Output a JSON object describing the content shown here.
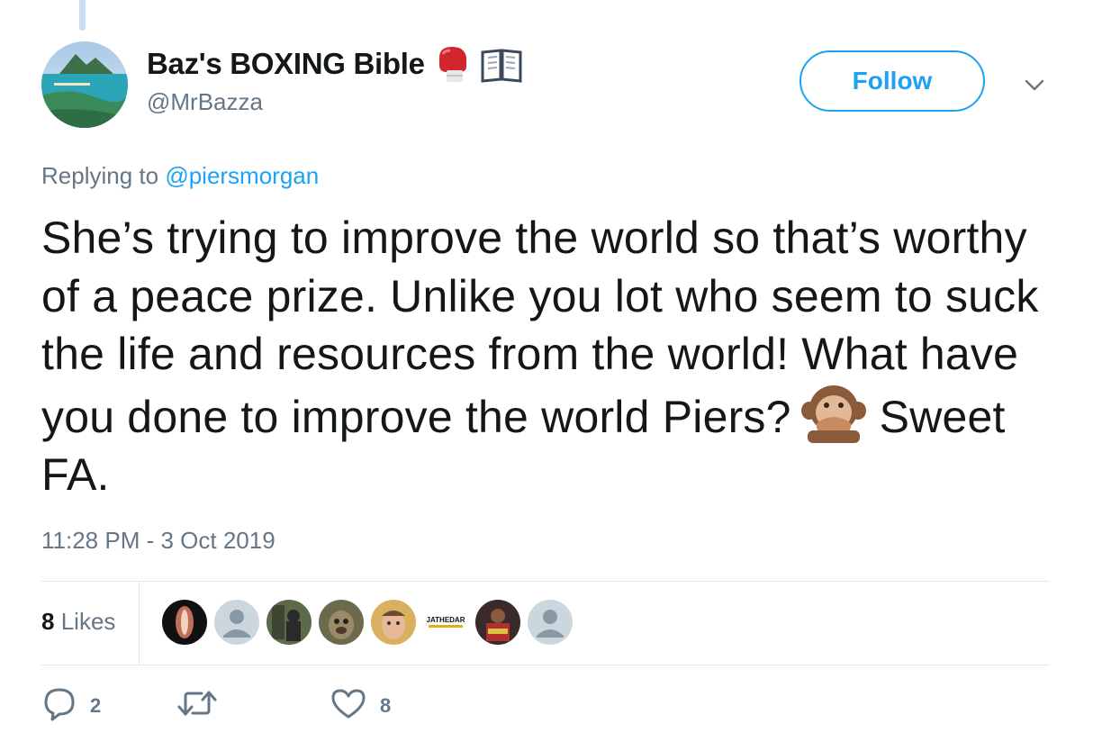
{
  "user": {
    "display_name": "Baz's BOXING Bible",
    "handle": "@MrBazza",
    "name_emojis": [
      "boxing-glove-icon",
      "open-book-icon"
    ]
  },
  "follow_button": {
    "label": "Follow"
  },
  "reply_context": {
    "prefix": "Replying to",
    "mention": "@piersmorgan"
  },
  "tweet": {
    "text_before_emoji": "She’s trying to improve the world so that’s worthy of a peace prize. Unlike you lot who seem to suck the life and resources from the world! What have you done to improve the world Piers?",
    "inline_emoji": "speak-no-evil-monkey-icon",
    "text_after_emoji": "Sweet FA.",
    "timestamp": "11:28 PM - 3 Oct 2019"
  },
  "likes": {
    "count": "8",
    "label": "Likes",
    "likers": [
      {
        "name": "liker-1",
        "color": "#1a1a1a"
      },
      {
        "name": "liker-2",
        "color": "#ccd6dd"
      },
      {
        "name": "liker-3",
        "color": "#4a5a3a"
      },
      {
        "name": "liker-4",
        "color": "#7a6a4a"
      },
      {
        "name": "liker-5",
        "color": "#c8a050"
      },
      {
        "name": "liker-6",
        "text": "JATHEDAR",
        "color": "#ffffff"
      },
      {
        "name": "liker-7",
        "color": "#8a3030"
      },
      {
        "name": "liker-8",
        "color": "#ccd6dd"
      }
    ]
  },
  "actions": {
    "reply_count": "2",
    "retweet_count": "",
    "like_count": "8"
  },
  "colors": {
    "accent": "#1da1f2",
    "secondary_text": "#657786",
    "primary_text": "#14171a",
    "divider": "#e1e8ed"
  }
}
